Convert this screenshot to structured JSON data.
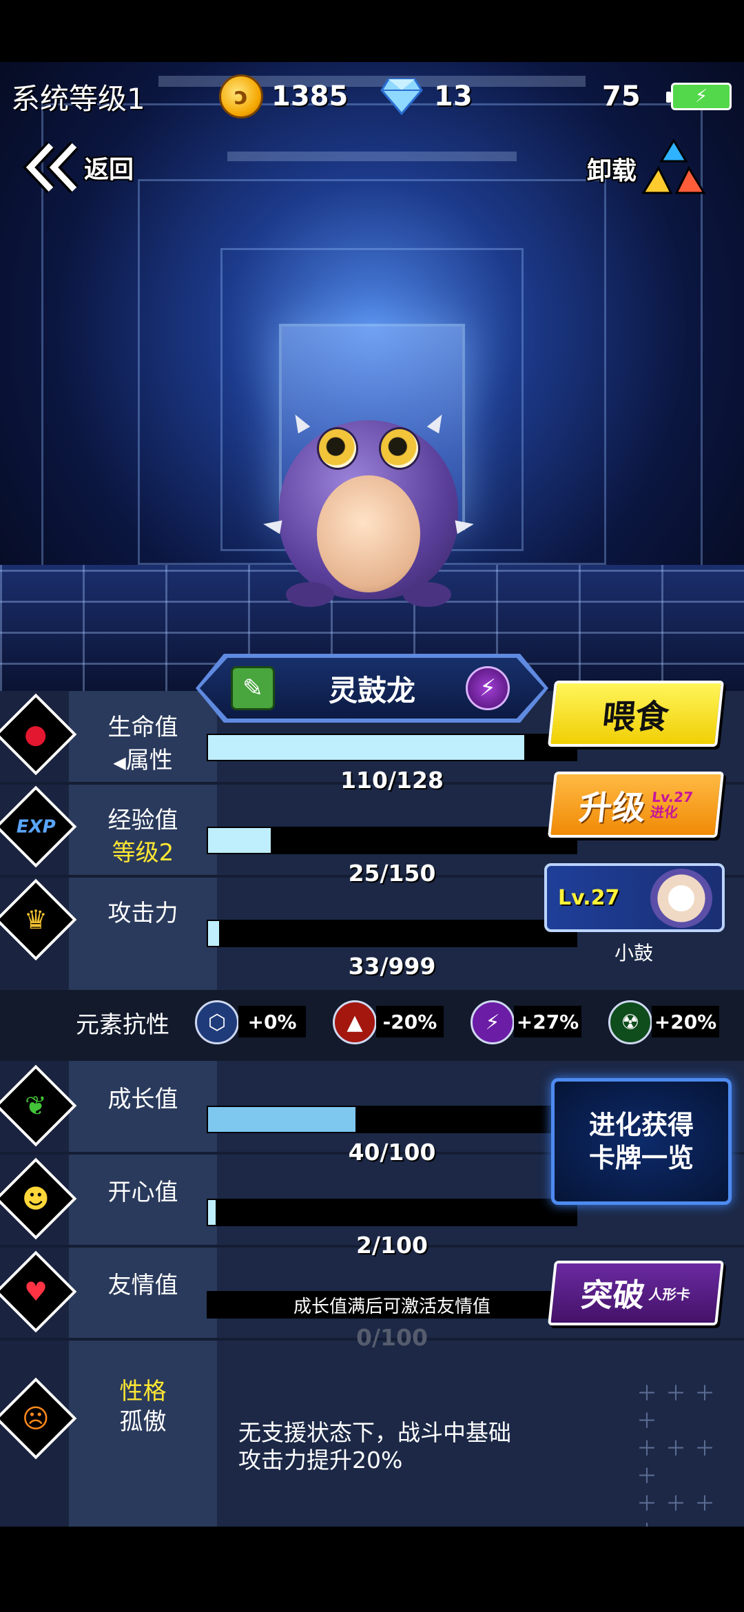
{
  "status_bar": {
    "system_level": "系统等级1",
    "coins": "1385",
    "diamonds": "13",
    "battery_level": "75"
  },
  "nav": {
    "back_label": "返回",
    "unload_label": "卸载"
  },
  "pet": {
    "name": "灵鼓龙"
  },
  "stats": {
    "hp": {
      "label": "生命值",
      "sub": "属性",
      "value": "110/128",
      "fill": 0.86
    },
    "exp": {
      "label": "经验值",
      "sub": "等级2",
      "value": "25/150",
      "fill": 0.17
    },
    "attack": {
      "label": "攻击力",
      "value": "33/999",
      "fill": 0.03
    },
    "growth": {
      "label": "成长值",
      "value": "40/100",
      "fill": 0.4
    },
    "happiness": {
      "label": "开心值",
      "value": "2/100",
      "fill": 0.02
    },
    "friendship": {
      "label": "友情值",
      "bar_text": "成长值满后可激活友情值",
      "value": "0/100"
    }
  },
  "resistance": {
    "label": "元素抗性",
    "values": [
      "+0%",
      "-20%",
      "+27%",
      "+20%"
    ]
  },
  "buttons": {
    "feed": "喂食",
    "upgrade": "升级",
    "upgrade_sub_lv": "Lv.27",
    "upgrade_sub_evolve": "进化",
    "evolve_line1": "进化获得",
    "evolve_line2": "卡牌一览",
    "breakthrough": "突破",
    "breakthrough_sub": "人形卡"
  },
  "card": {
    "level": "Lv.27",
    "name": "小鼓"
  },
  "trait": {
    "title": "性格",
    "name": "孤傲",
    "desc_line1": "无支援状态下，战斗中基础",
    "desc_line2": "攻击力提升20%"
  },
  "colors": {
    "feed": "#f5d80e",
    "upgrade": "#f39a15",
    "breakthrough": "#5a1f86",
    "bar_fill": "#bfeefc"
  }
}
